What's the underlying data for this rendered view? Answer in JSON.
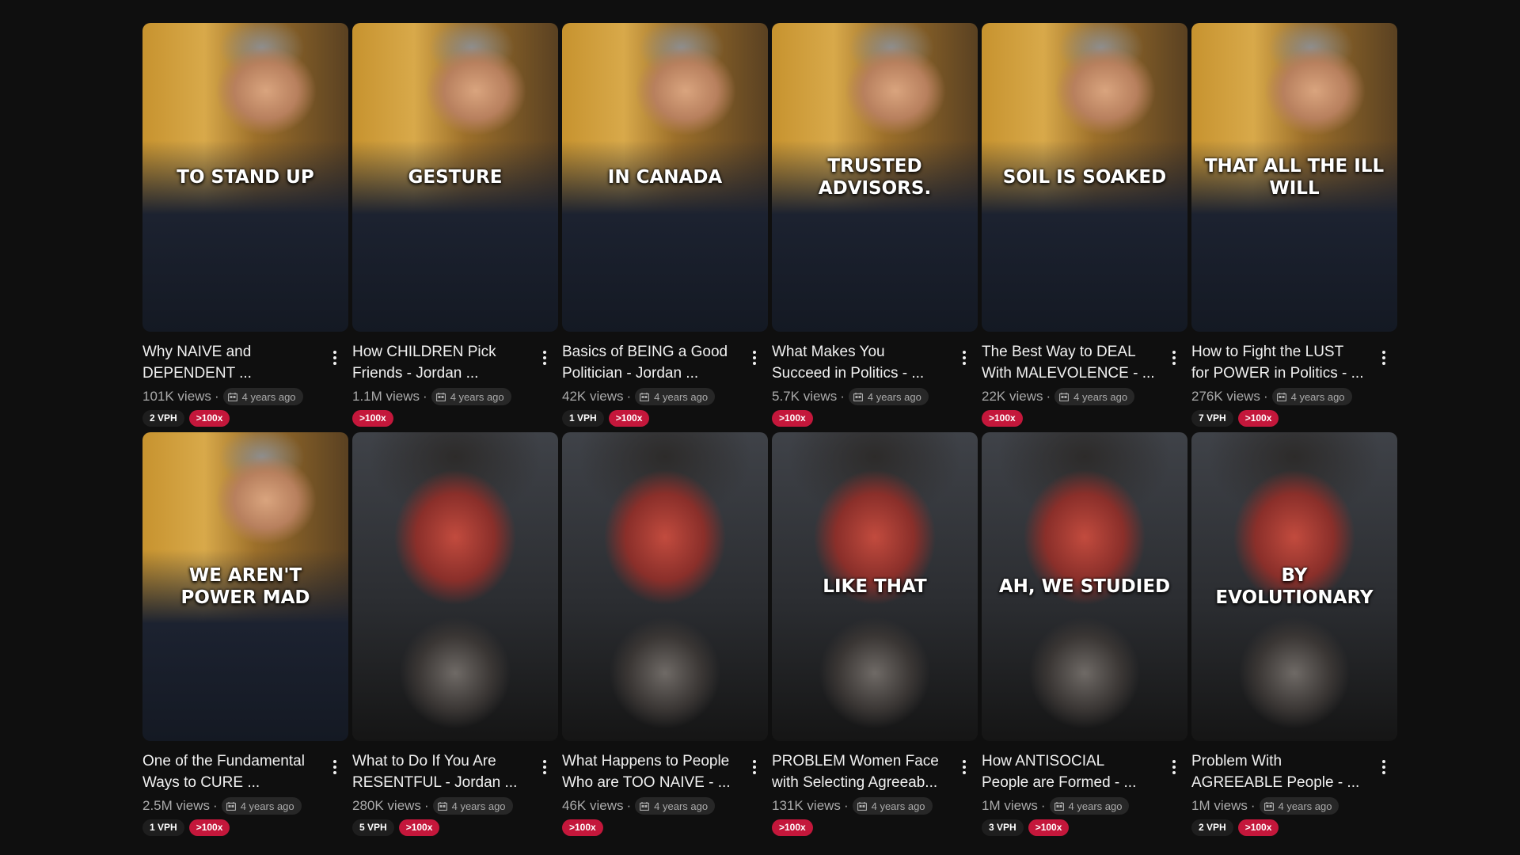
{
  "colors": {
    "background": "#0f0f0f",
    "outlier_badge": "#c4173b",
    "vph_badge": "#1e1e1e"
  },
  "icons": {
    "menu": "more-vert-icon",
    "age": "calendar-icon"
  },
  "videos": [
    {
      "thumb_style": "warm",
      "caption": "TO STAND UP",
      "title": "Why NAIVE and\nDEPENDENT ...",
      "views": "101K views",
      "age": "4 years ago",
      "vph": "2 VPH",
      "outlier": ">100x"
    },
    {
      "thumb_style": "warm",
      "caption": "GESTURE",
      "title": "How CHILDREN Pick\nFriends - Jordan ...",
      "views": "1.1M views",
      "age": "4 years ago",
      "vph": "",
      "outlier": ">100x"
    },
    {
      "thumb_style": "warm",
      "caption": "IN CANADA",
      "title": "Basics of BEING a Good\nPolitician - Jordan ...",
      "views": "42K views",
      "age": "4 years ago",
      "vph": "1 VPH",
      "outlier": ">100x"
    },
    {
      "thumb_style": "warm",
      "caption": "TRUSTED\nADVISORS.",
      "title": "What Makes You\nSucceed in Politics - ...",
      "views": "5.7K views",
      "age": "4 years ago",
      "vph": "",
      "outlier": ">100x"
    },
    {
      "thumb_style": "warm",
      "caption": "SOIL IS SOAKED",
      "title": "The Best Way to DEAL\nWith MALEVOLENCE - ...",
      "views": "22K views",
      "age": "4 years ago",
      "vph": "",
      "outlier": ">100x"
    },
    {
      "thumb_style": "warm",
      "caption": "THAT ALL THE ILL\nWILL",
      "title": "How to Fight the LUST\nfor POWER in Politics - ...",
      "views": "276K views",
      "age": "4 years ago",
      "vph": "7 VPH",
      "outlier": ">100x"
    },
    {
      "thumb_style": "warm",
      "caption": "WE AREN'T\nPOWER MAD",
      "title": "One of the Fundamental\nWays to CURE ...",
      "views": "2.5M views",
      "age": "4 years ago",
      "vph": "1 VPH",
      "outlier": ">100x"
    },
    {
      "thumb_style": "red",
      "caption": "",
      "title": "What to Do If You Are\nRESENTFUL - Jordan ...",
      "views": "280K views",
      "age": "4 years ago",
      "vph": "5 VPH",
      "outlier": ">100x"
    },
    {
      "thumb_style": "red",
      "caption": "",
      "title": "What Happens to People\nWho are TOO NAIVE - ...",
      "views": "46K views",
      "age": "4 years ago",
      "vph": "",
      "outlier": ">100x"
    },
    {
      "thumb_style": "red",
      "caption": "LIKE THAT",
      "title": "PROBLEM Women Face\nwith Selecting Agreeab...",
      "views": "131K views",
      "age": "4 years ago",
      "vph": "",
      "outlier": ">100x"
    },
    {
      "thumb_style": "red",
      "caption": "AH, WE STUDIED",
      "title": "How ANTISOCIAL\nPeople are Formed - ...",
      "views": "1M views",
      "age": "4 years ago",
      "vph": "3 VPH",
      "outlier": ">100x"
    },
    {
      "thumb_style": "red",
      "caption": "BY\nEVOLUTIONARY",
      "title": "Problem With\nAGREEABLE People - ...",
      "views": "1M views",
      "age": "4 years ago",
      "vph": "2 VPH",
      "outlier": ">100x"
    }
  ]
}
